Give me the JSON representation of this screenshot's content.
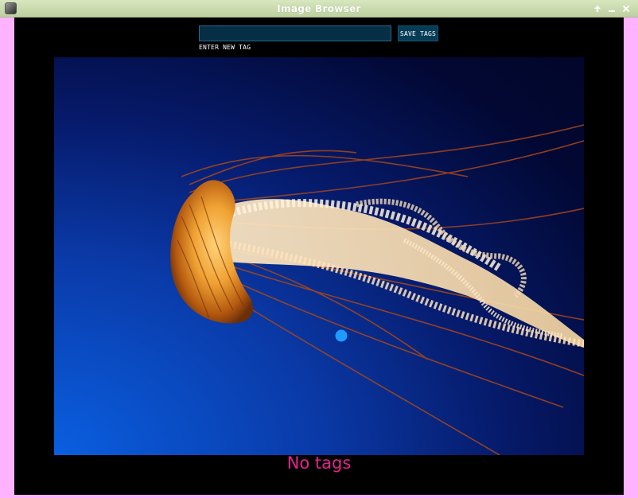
{
  "window": {
    "title": "Image Browser",
    "icons": {
      "app": "app-icon",
      "up": "up-arrow-icon",
      "minimize": "minimize-icon",
      "close": "close-icon"
    }
  },
  "tagger": {
    "input_value": "",
    "input_caption": "ENTER NEW TAG",
    "save_label": "SAVE TAGS"
  },
  "image": {
    "subject": "jellyfish",
    "marker": "cursor-dot"
  },
  "tags": {
    "status_text": "No tags"
  },
  "colors": {
    "window_bg": "#ffb3ff",
    "content_bg": "#000000",
    "button_bg": "#073c57",
    "tags_text": "#e6238f",
    "marker": "#1f9bff"
  }
}
